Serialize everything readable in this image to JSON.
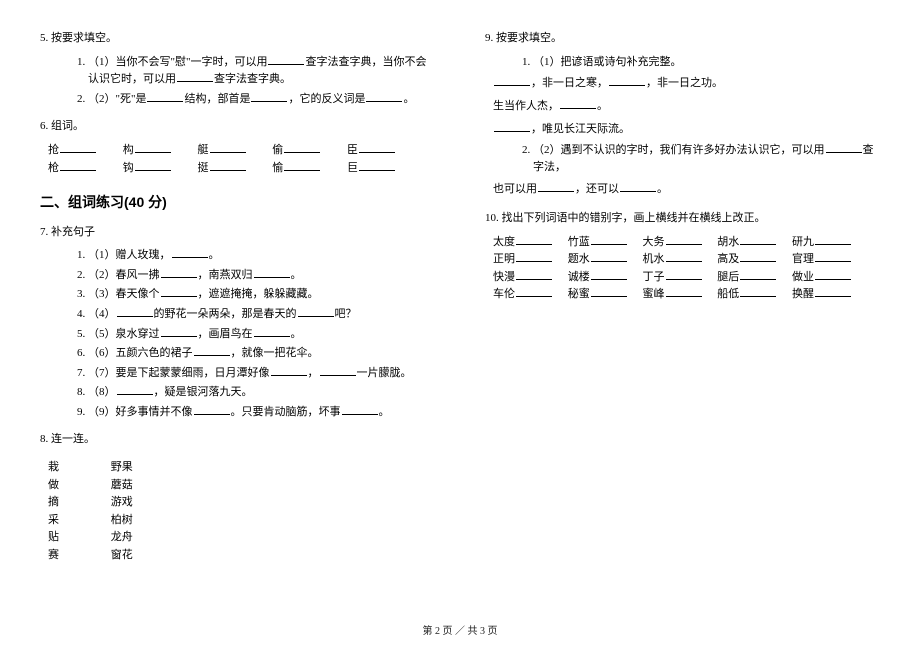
{
  "q5": {
    "head": "5.  按要求填空。",
    "items": [
      "（1）当你不会写\"慰\"一字时，可以用______查字法查字典，当你不会认识它时，可以用______查字法查字典。",
      "（2）\"死\"是______结构，部首是______，它的反义词是______。"
    ]
  },
  "q6": {
    "head": "6.  组词。",
    "rows": [
      [
        "抢______",
        "构______",
        "艇______",
        "偷______",
        "臣______"
      ],
      [
        "枪______",
        "钩______",
        "挺______",
        "愉______",
        "巨______"
      ]
    ]
  },
  "section2": "二、组词练习(40 分)",
  "q7": {
    "head": "7.  补充句子",
    "items": [
      "（1）赠人玫瑰，______。",
      "（2）春风一拂______，南燕双归______。",
      "（3）春天像个______，遮遮掩掩，躲躲藏藏。",
      "（4）______的野花一朵两朵，那是春天的______吧？",
      "（5）泉水穿过______，画眉鸟在______。",
      "（6）五颜六色的裙子______，就像一把花伞。",
      "（7）要是下起蒙蒙细雨，日月潭好像______，______一片朦胧。",
      "（8）______，疑是银河落九天。",
      "（9）好多事情并不像______。只要肯动脑筋，坏事______。"
    ]
  },
  "q8": {
    "head": "8.  连一连。",
    "pairs": [
      [
        "栽",
        "野果"
      ],
      [
        "做",
        "蘑菇"
      ],
      [
        "摘",
        "游戏"
      ],
      [
        "采",
        "柏树"
      ],
      [
        "贴",
        "龙舟"
      ],
      [
        "赛",
        "窗花"
      ]
    ]
  },
  "q9": {
    "head": "9.  按要求填空。",
    "sub1_label": "（1）把谚语或诗句补充完整。",
    "line1": "______，非一日之寒，______，非一日之功。",
    "line2": "生当作人杰，______。",
    "line3": "______，唯见长江天际流。",
    "sub2_label": "（2）遇到不认识的字时，我们有许多好办法认识它，可以用______查字法，",
    "line4": "也可以用______，还可以______。"
  },
  "q10": {
    "head": "10.  找出下列词语中的错别字，画上横线并在横线上改正。",
    "rows": [
      [
        "太度______",
        "竹蓝______",
        "大务______",
        "胡水______",
        "研九______"
      ],
      [
        "正明______",
        "题水______",
        "机水______",
        "高及______",
        "官理______"
      ],
      [
        "快漫______",
        "诚楼______",
        "丁子______",
        "腿后______",
        "做业______"
      ],
      [
        "车伦______",
        "秘蜜______",
        "蜜峰______",
        "船低______",
        "换醒______"
      ]
    ]
  },
  "footer": "第 2 页 ／ 共 3 页"
}
